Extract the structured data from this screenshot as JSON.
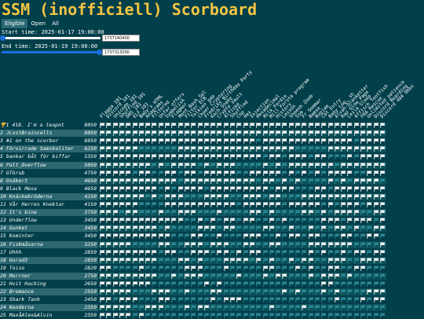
{
  "header": {
    "title": "SSM (inofficiell) Scorboard"
  },
  "tabs": [
    {
      "label": "Eligible",
      "active": true
    },
    {
      "label": "Open",
      "active": false
    },
    {
      "label": "All",
      "active": false
    }
  ],
  "start": {
    "label": "Start time: 2025-01-17 19:00:00",
    "value": "1737140400",
    "position": 0.0
  },
  "end": {
    "label": "End time: 2025-01-19 19:00:00",
    "value": "1737313200",
    "position": 1.0
  },
  "challenges": [
    "Flagga 101",
    "Discord 101",
    "Unicode 101",
    "Shuffled 101",
    "DNS 101",
    "ELF 101",
    "Baby's HTML",
    "Anagrams",
    "Filtered",
    "Unfar offers",
    "Symbolisk",
    "Flagmor",
    "Mont Bash Sql",
    "Filter ECB",
    "Tolkien gap",
    "Cheer Cryptering",
    "Fredriks Birthday Party",
    "Koch Snake",
    "Crypto Vault",
    "Alfiske",
    "Shuffled",
    "Cop",
    "Hex",
    "Injection",
    "Hexadecimal",
    "Milk Ferdie",
    "Mill Forsta program",
    "History",
    "Lesson",
    "Sheesh Zoom",
    "Ssm",
    "Fr Sommar",
    "Bamse",
    "Bugjam",
    "Cat Entry",
    "Baby Log, sh",
    "Alvah-blanketter",
    "Rap Glow Page",
    "Leila Sleep",
    "Affisch Tentfish",
    "FRA Rescue",
    "Unlimited patience",
    "Discord Boarding",
    "Discord 404 Obbs"
  ],
  "status_colors": {
    "solved": "#ffffff",
    "unsolved": "#2e8a96",
    "first_blood": "#f5c542"
  },
  "trophy_icon": "trophy-icon",
  "teams": [
    {
      "rank": "1",
      "name": "418. I'm a teapot",
      "score": "8050",
      "trophy": true,
      "solves": "11111111111111111111111111111111111111111111"
    },
    {
      "rank": "2",
      "name": "JLostBraincells",
      "score": "8050",
      "trophy": false,
      "solves": "11111111111111111111111111111111111111111111"
    },
    {
      "rank": "3",
      "name": "#1 on the scorbor",
      "score": "6950",
      "trophy": false,
      "solves": "11111111111111111111111101111111111111101111"
    },
    {
      "rank": "4",
      "name": "Förvirrade Samskoliter",
      "score": "6250",
      "trophy": false,
      "solves": "11111100000011111111111111111100000111111111"
    },
    {
      "rank": "5",
      "name": "bankar båt för biffar",
      "score": "5350",
      "trophy": false,
      "solves": "11111111111111111111111110110111011000101111"
    },
    {
      "rank": "6",
      "name": "Palt_Overflow",
      "score": "5050",
      "trophy": false,
      "solves": "11111111010111101011100001010111111101111111"
    },
    {
      "rank": "7",
      "name": "GTGrub",
      "score": "4750",
      "trophy": false,
      "solves": "11111011001101101111100111110101010111100111"
    },
    {
      "rank": "8",
      "name": "Osäkert",
      "score": "4650",
      "trophy": false,
      "solves": "11111111111101111111111101101010000101011110"
    },
    {
      "rank": "9",
      "name": "Black Mesa",
      "score": "4650",
      "trophy": false,
      "solves": "11111111101011110111111111011100011011111111"
    },
    {
      "rank": "10",
      "name": "Knäckebröderna",
      "score": "4250",
      "trophy": false,
      "solves": "11111110101110001111001110110001111111111111"
    },
    {
      "rank": "11",
      "name": "Vår Herres Knektar",
      "score": "4150",
      "trophy": false,
      "solves": "11111100001111111111101111110111110101110111"
    },
    {
      "rank": "12",
      "name": "It's bine",
      "score": "3750",
      "trophy": false,
      "solves": "11101100010011100010000110100001101011110011"
    },
    {
      "rank": "13",
      "name": "Underflow",
      "score": "3450",
      "trophy": false,
      "solves": "11111111111110010101101100101000001110111101"
    },
    {
      "rank": "14",
      "name": "Gunket",
      "score": "3450",
      "trophy": false,
      "solves": "11111111101000011101100001100100101011010011"
    },
    {
      "rank": "15",
      "name": "Kominter",
      "score": "3450",
      "trophy": false,
      "solves": "11111111111000110010001110010110110001100110"
    },
    {
      "rank": "16",
      "name": "Fiskmåsarna",
      "score": "3250",
      "trophy": false,
      "solves": "11111000011001110111001100110000111111100001"
    },
    {
      "rank": "17",
      "name": "Uhhh",
      "score": "2850",
      "trophy": false,
      "solves": "11111111101100111011010110000000101001011011"
    },
    {
      "rank": "18",
      "name": "Gurad3",
      "score": "2850",
      "trophy": false,
      "solves": "11111111100011010001111010100101100111001111"
    },
    {
      "rank": "19",
      "name": "Toiso",
      "score": "2820",
      "trophy": false,
      "solves": "11000010000001110001000001100010100110011000"
    },
    {
      "rank": "20",
      "name": "Morrnor",
      "score": "2750",
      "trophy": false,
      "solves": "11111111100101110000010001011000101110100000"
    },
    {
      "rank": "21",
      "name": "Hvit Hacking",
      "score": "2650",
      "trophy": false,
      "solves": "11111111000000001010000000000000001100000000"
    },
    {
      "rank": "22",
      "name": "Bromance",
      "score": "2550",
      "trophy": false,
      "solves": "11111000111001000110000000001010001010000111"
    },
    {
      "rank": "23",
      "name": "Shark Tank",
      "score": "2450",
      "trophy": false,
      "solves": "11011100011000000101110000000000000010001011"
    },
    {
      "rank": "24",
      "name": "Nanderna",
      "score": "2350",
      "trophy": false,
      "solves": "11111001110001011000000000100001000000000000"
    },
    {
      "rank": "25",
      "name": "MaxåAlex&Alvin",
      "score": "2350",
      "trophy": false,
      "solves": "11111010000000000000000000000000000000000000"
    }
  ]
}
